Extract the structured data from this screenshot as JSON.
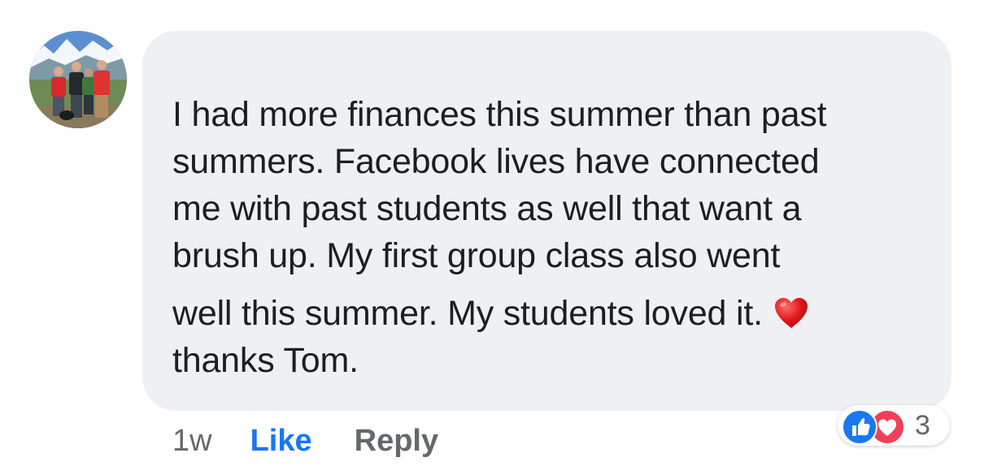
{
  "comment": {
    "avatar": {
      "icon": "profile-photo-avatar"
    },
    "text_lines": [
      "I had more finances this summer than past",
      "summers. Facebook lives have connected",
      "me with past students as well that want a",
      "brush up. My first group class also went",
      "well this summer. My students loved it.",
      "thanks Tom."
    ],
    "emoji": {
      "icon": "red-heart-emoji",
      "color": "#e0161c"
    },
    "actions": {
      "timestamp": "1w",
      "like_label": "Like",
      "reply_label": "Reply"
    },
    "reactions": {
      "icons": [
        "like-reaction-icon",
        "love-reaction-icon"
      ],
      "count": "3",
      "like_color": "#1877f2",
      "love_color": "#f33e58"
    }
  },
  "colors": {
    "bubble_background": "#eff0f3",
    "text": "#1c1e21",
    "secondary_text": "#65676b",
    "link_blue": "#1877f2"
  }
}
